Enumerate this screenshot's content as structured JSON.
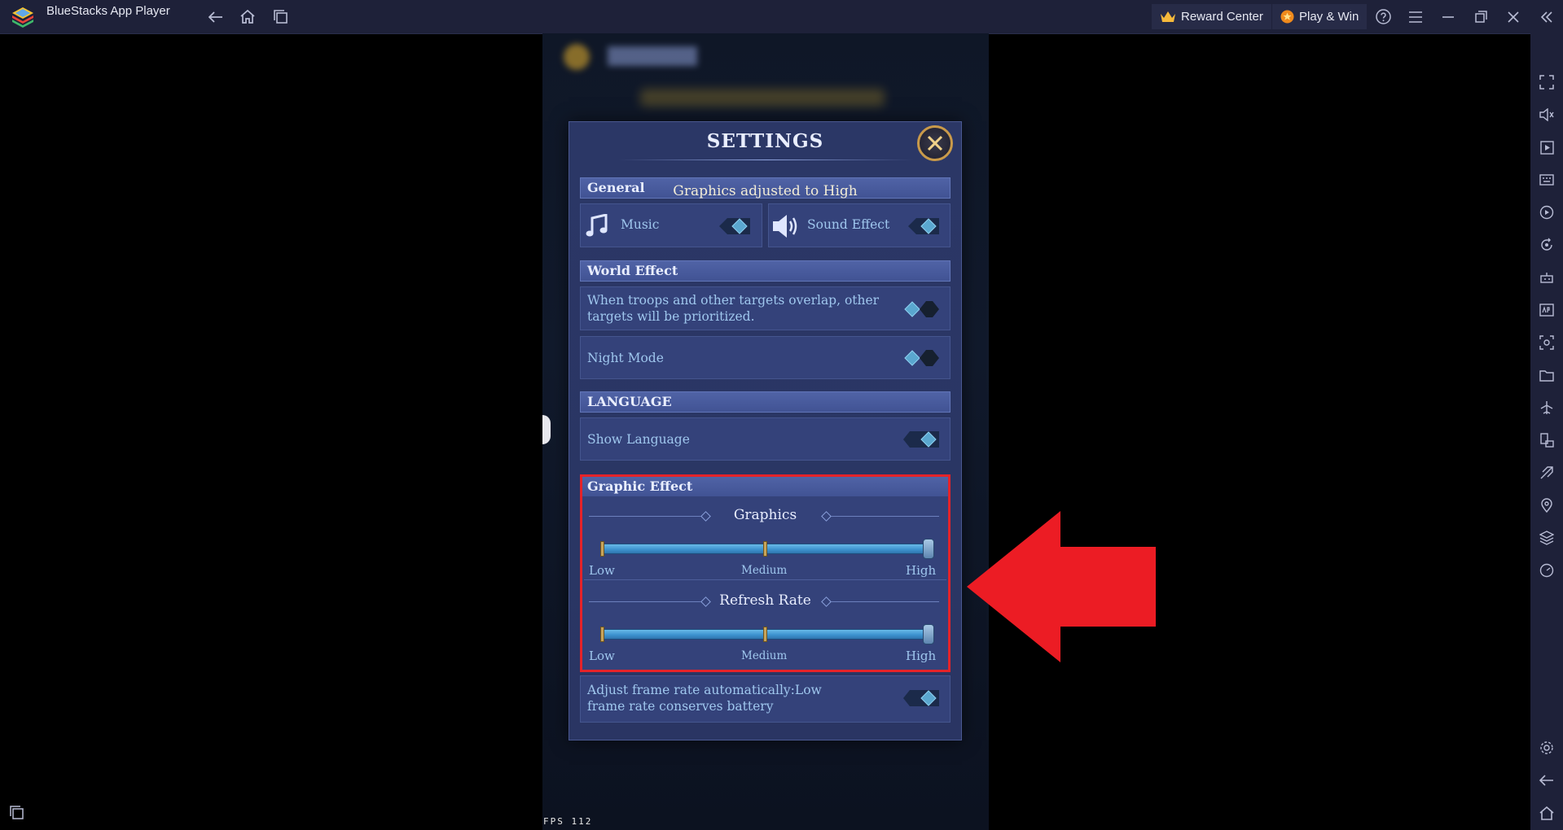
{
  "titlebar": {
    "app_title": "BlueStacks App Player",
    "reward_center": "Reward Center",
    "play_win": "Play & Win"
  },
  "settings": {
    "title": "SETTINGS",
    "toast": "Graphics adjusted to High",
    "general": {
      "header": "General",
      "music_label": "Music",
      "music_on": true,
      "sound_label": "Sound Effect",
      "sound_on": true
    },
    "world_effect": {
      "header": "World Effect",
      "overlap_text": "When troops and other targets overlap, other targets will be prioritized.",
      "overlap_on": false,
      "night_mode_label": "Night Mode",
      "night_mode_on": false
    },
    "language": {
      "header": "LANGUAGE",
      "show_language_label": "Show Language",
      "show_language_on": true
    },
    "graphic_effect": {
      "header": "Graphic Effect",
      "graphics": {
        "label": "Graphics",
        "levels": [
          "Low",
          "Medium",
          "High"
        ],
        "selected": "High"
      },
      "refresh_rate": {
        "label": "Refresh Rate",
        "levels": [
          "Low",
          "Medium",
          "High"
        ],
        "selected": "High"
      },
      "auto_frame_text": "Adjust frame rate automatically:Low frame rate conserves battery",
      "auto_frame_on": true
    }
  },
  "fps_label": "FPS 112",
  "colors": {
    "titlebar_bg": "#1e2139",
    "panel_bg": "#2b3766",
    "highlight": "#e52329",
    "toggle_on": "#5aa7cf",
    "toggle_off": "#1b2334"
  }
}
